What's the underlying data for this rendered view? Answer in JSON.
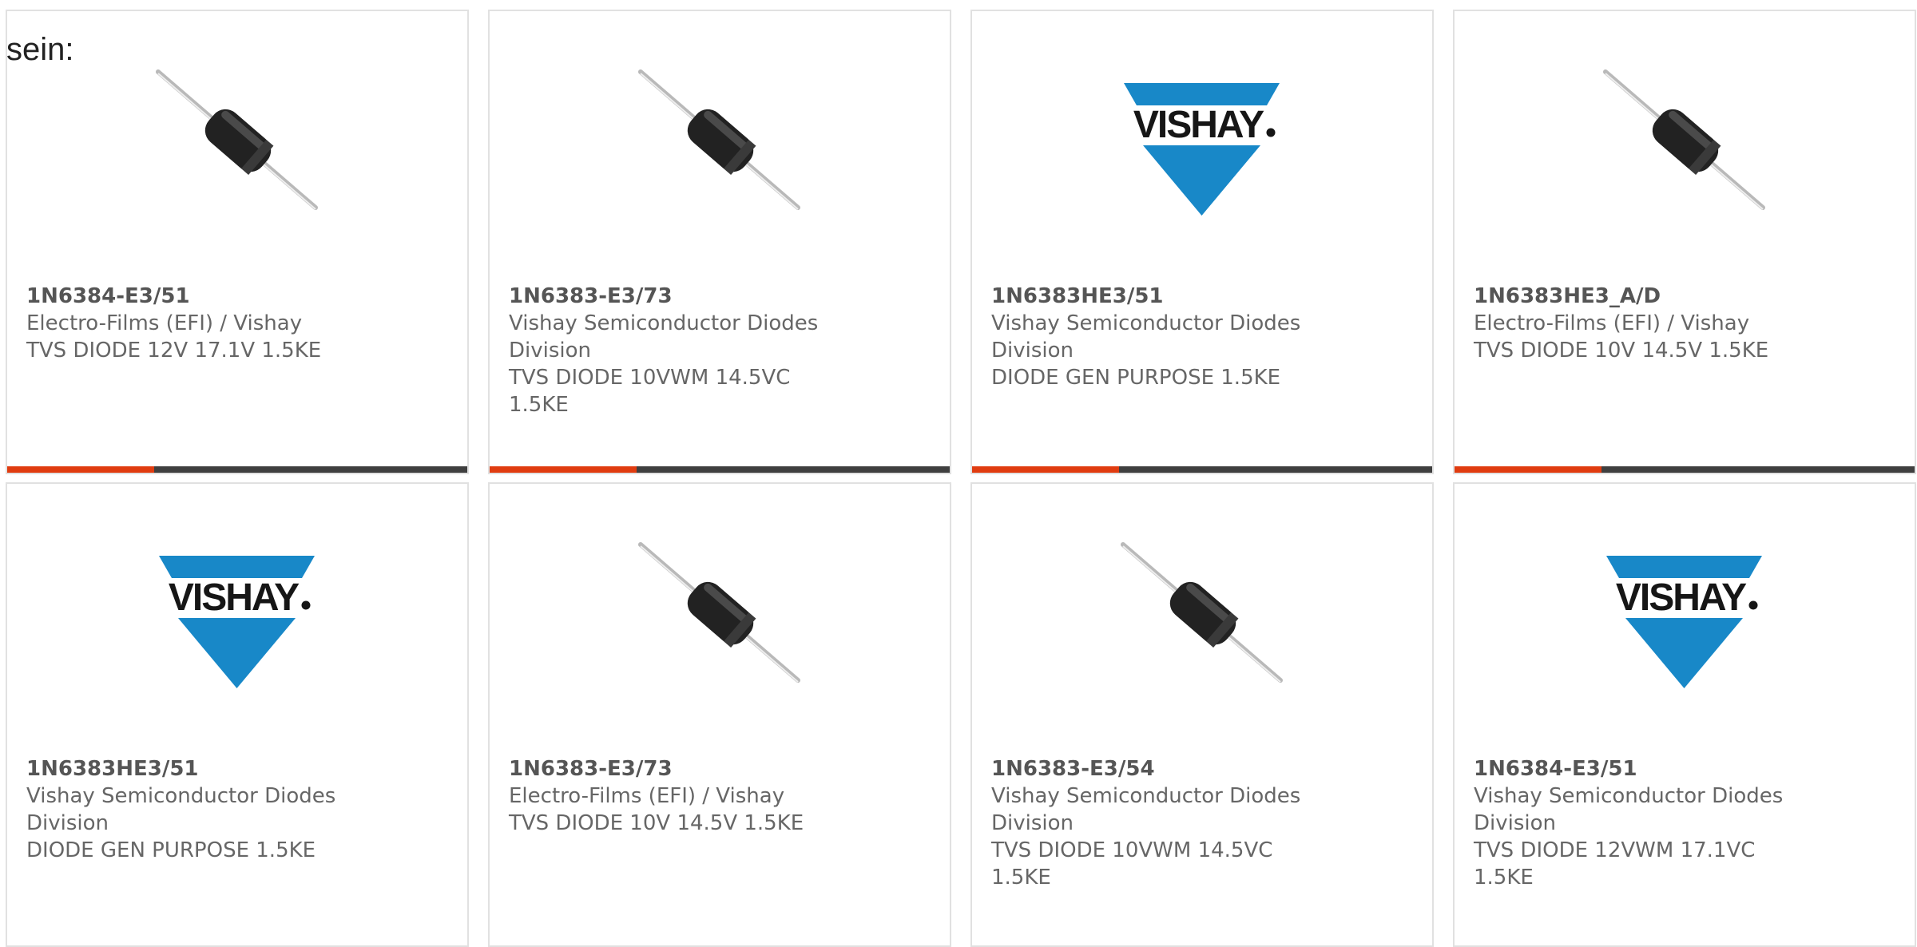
{
  "intro_text": "sein:",
  "colors": {
    "progress_accent": "#e03c10",
    "progress_track": "#3f3f3f",
    "vishay_blue": "#1888c8",
    "card_border": "#e1e1e1"
  },
  "products": [
    {
      "part": "1N6384-E3/51",
      "maker": "Electro-Films (EFI) / Vishay",
      "desc": "TVS DIODE 12V 17.1V 1.5KE",
      "image": "diode-icon",
      "bar_progress": 0.32
    },
    {
      "part": "1N6383-E3/73",
      "maker": "Vishay Semiconductor Diodes Division",
      "desc": "TVS DIODE 10VWM 14.5VC 1.5KE",
      "image": "diode-icon",
      "bar_progress": 0.32
    },
    {
      "part": "1N6383HE3/51",
      "maker": "Vishay Semiconductor Diodes Division",
      "desc": "DIODE GEN PURPOSE 1.5KE",
      "image": "vishay-logo",
      "bar_progress": 0.32
    },
    {
      "part": "1N6383HE3_A/D",
      "maker": "Electro-Films (EFI) / Vishay",
      "desc": "TVS DIODE 10V 14.5V 1.5KE",
      "image": "diode-icon",
      "bar_progress": 0.32
    },
    {
      "part": "1N6383HE3/51",
      "maker": "Vishay Semiconductor Diodes Division",
      "desc": "DIODE GEN PURPOSE 1.5KE",
      "image": "vishay-logo",
      "bar_progress": 0
    },
    {
      "part": "1N6383-E3/73",
      "maker": "Electro-Films (EFI) / Vishay",
      "desc": "TVS DIODE 10V 14.5V 1.5KE",
      "image": "diode-icon",
      "bar_progress": 0
    },
    {
      "part": "1N6383-E3/54",
      "maker": "Vishay Semiconductor Diodes Division",
      "desc": "TVS DIODE 10VWM 14.5VC 1.5KE",
      "image": "diode-icon",
      "bar_progress": 0
    },
    {
      "part": "1N6384-E3/51",
      "maker": "Vishay Semiconductor Diodes Division",
      "desc": "TVS DIODE 12VWM 17.1VC 1.5KE",
      "image": "vishay-logo",
      "bar_progress": 0
    }
  ]
}
